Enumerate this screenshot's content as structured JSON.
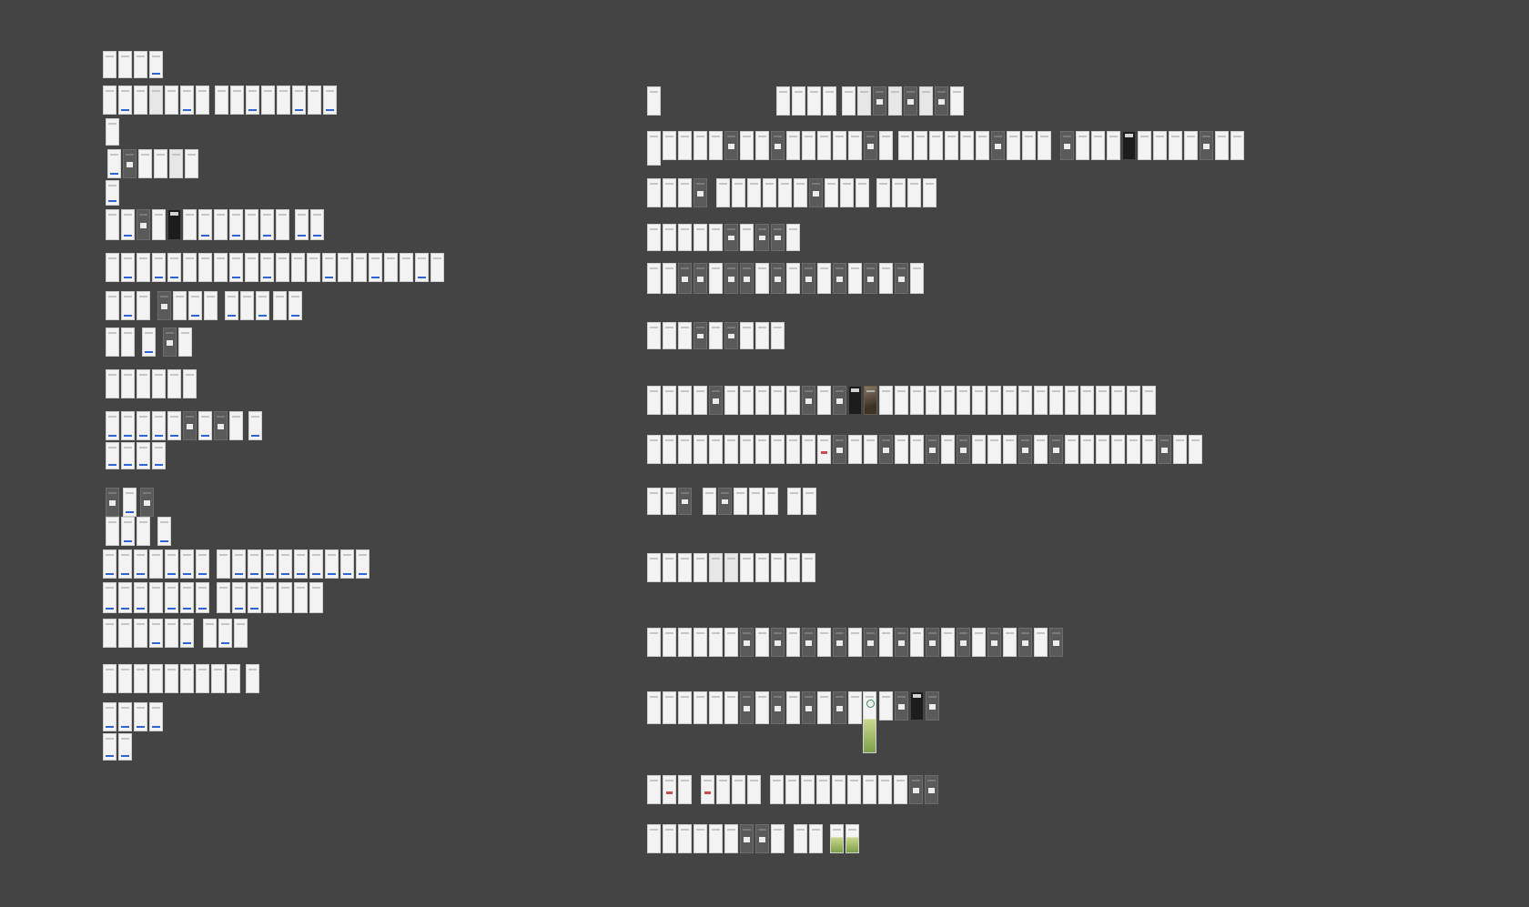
{
  "canvas": {
    "background": "#444444",
    "artboard_fill": "#f3f3f3",
    "accent": "#2f63d8",
    "artboard_types": [
      "plain",
      "alt",
      "blue-cta",
      "dark-modal",
      "black-header",
      "photo",
      "green-card",
      "ring",
      "red-accent"
    ]
  }
}
